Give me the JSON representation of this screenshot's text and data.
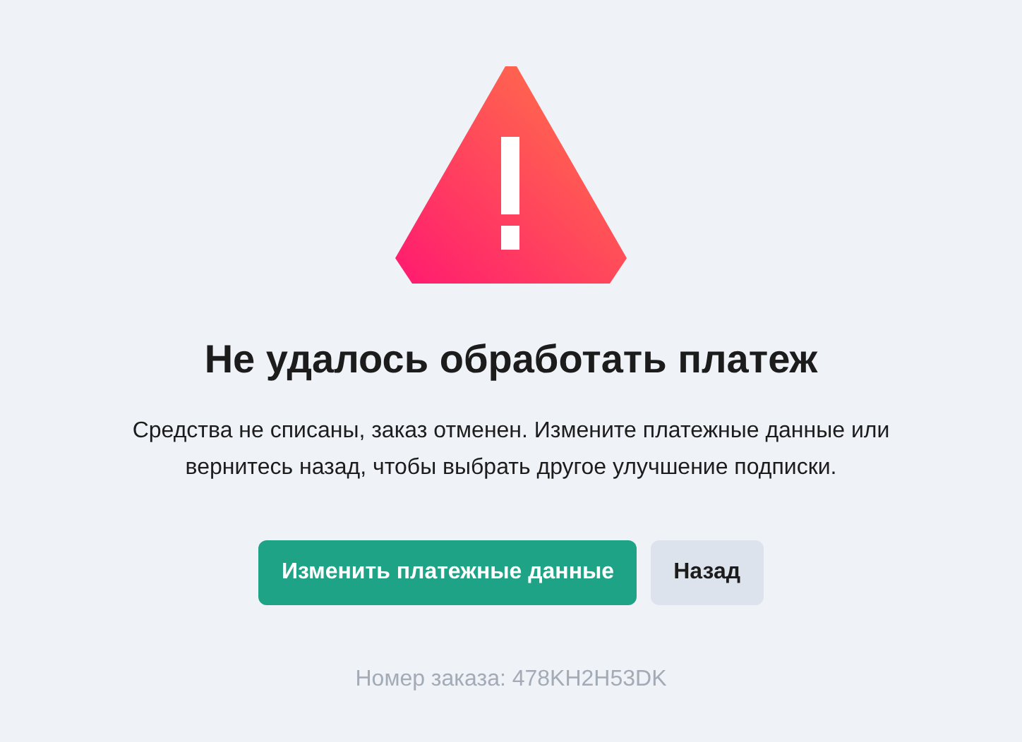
{
  "title": "Не удалось обработать платеж",
  "message": "Средства не списаны, заказ отменен. Измените платежные данные или вернитесь назад, чтобы выбрать другое улучшение подписки.",
  "buttons": [
    {
      "kind": "primary",
      "label": "Изменить платежные данные"
    },
    {
      "kind": "secondary",
      "label": "Назад"
    }
  ],
  "order_number": "Номер заказа: 478KH2H53DK"
}
